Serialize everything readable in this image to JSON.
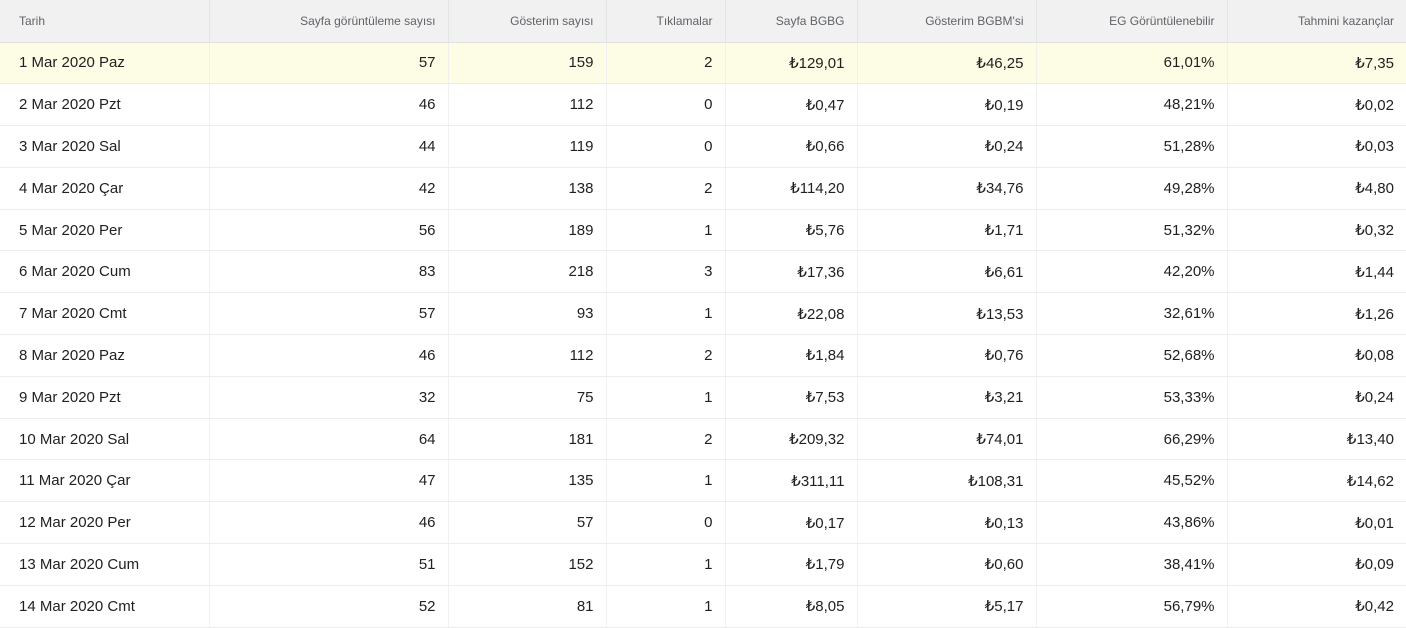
{
  "table": {
    "headers": [
      "Tarih",
      "Sayfa görüntüleme sayısı",
      "Gösterim sayısı",
      "Tıklamalar",
      "Sayfa BGBG",
      "Gösterim BGBM'si",
      "EG Görüntülenebilir",
      "Tahmini kazançlar"
    ],
    "rows": [
      [
        "1 Mar 2020 Paz",
        "57",
        "159",
        "2",
        "₺129,01",
        "₺46,25",
        "61,01%",
        "₺7,35"
      ],
      [
        "2 Mar 2020 Pzt",
        "46",
        "112",
        "0",
        "₺0,47",
        "₺0,19",
        "48,21%",
        "₺0,02"
      ],
      [
        "3 Mar 2020 Sal",
        "44",
        "119",
        "0",
        "₺0,66",
        "₺0,24",
        "51,28%",
        "₺0,03"
      ],
      [
        "4 Mar 2020 Çar",
        "42",
        "138",
        "2",
        "₺114,20",
        "₺34,76",
        "49,28%",
        "₺4,80"
      ],
      [
        "5 Mar 2020 Per",
        "56",
        "189",
        "1",
        "₺5,76",
        "₺1,71",
        "51,32%",
        "₺0,32"
      ],
      [
        "6 Mar 2020 Cum",
        "83",
        "218",
        "3",
        "₺17,36",
        "₺6,61",
        "42,20%",
        "₺1,44"
      ],
      [
        "7 Mar 2020 Cmt",
        "57",
        "93",
        "1",
        "₺22,08",
        "₺13,53",
        "32,61%",
        "₺1,26"
      ],
      [
        "8 Mar 2020 Paz",
        "46",
        "112",
        "2",
        "₺1,84",
        "₺0,76",
        "52,68%",
        "₺0,08"
      ],
      [
        "9 Mar 2020 Pzt",
        "32",
        "75",
        "1",
        "₺7,53",
        "₺3,21",
        "53,33%",
        "₺0,24"
      ],
      [
        "10 Mar 2020 Sal",
        "64",
        "181",
        "2",
        "₺209,32",
        "₺74,01",
        "66,29%",
        "₺13,40"
      ],
      [
        "11 Mar 2020 Çar",
        "47",
        "135",
        "1",
        "₺311,11",
        "₺108,31",
        "45,52%",
        "₺14,62"
      ],
      [
        "12 Mar 2020 Per",
        "46",
        "57",
        "0",
        "₺0,17",
        "₺0,13",
        "43,86%",
        "₺0,01"
      ],
      [
        "13 Mar 2020 Cum",
        "51",
        "152",
        "1",
        "₺1,79",
        "₺0,60",
        "38,41%",
        "₺0,09"
      ],
      [
        "14 Mar 2020 Cmt",
        "52",
        "81",
        "1",
        "₺8,05",
        "₺5,17",
        "56,79%",
        "₺0,42"
      ]
    ],
    "highlight_color": "#fdfde6",
    "header_bg": "#f1f1f1"
  }
}
